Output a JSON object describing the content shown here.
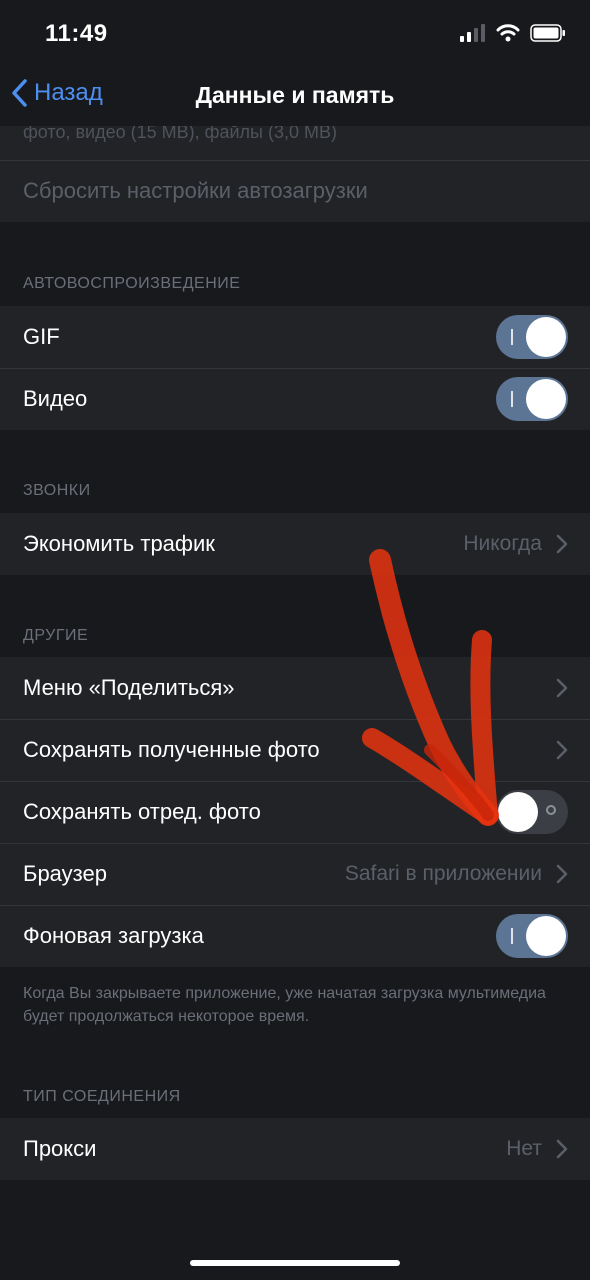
{
  "status": {
    "time": "11:49"
  },
  "nav": {
    "back_label": "Назад",
    "title": "Данные и память"
  },
  "top_group": {
    "partial_text": "фото, видео (15 MB), файлы (3,0 MB)",
    "reset_label": "Сбросить настройки автозагрузки"
  },
  "autoplay": {
    "header": "АВТОВОСПРОИЗВЕДЕНИЕ",
    "items": [
      {
        "label": "GIF",
        "toggle": "on"
      },
      {
        "label": "Видео",
        "toggle": "on"
      }
    ]
  },
  "calls": {
    "header": "ЗВОНКИ",
    "items": [
      {
        "label": "Экономить трафик",
        "value": "Никогда"
      }
    ]
  },
  "other": {
    "header": "ДРУГИЕ",
    "items": [
      {
        "label": "Меню «Поделиться»"
      },
      {
        "label": "Сохранять полученные фото"
      },
      {
        "label": "Сохранять отред. фото",
        "toggle": "off"
      },
      {
        "label": "Браузер",
        "value": "Safari в приложении"
      },
      {
        "label": "Фоновая загрузка",
        "toggle": "on"
      }
    ],
    "footer": "Когда Вы закрываете приложение, уже начатая загрузка мультимедиа будет продолжаться некоторое время."
  },
  "connection": {
    "header": "ТИП СОЕДИНЕНИЯ",
    "items": [
      {
        "label": "Прокси",
        "value": "Нет"
      }
    ]
  },
  "colors": {
    "background": "#18191d",
    "cell": "#212327",
    "accent": "#4c8ff0",
    "toggle_on": "#5d7594",
    "annotation_arrow": "#e8320f"
  },
  "icons": [
    "chevron-left-icon",
    "signal-icon",
    "wifi-icon",
    "battery-icon",
    "chevron-right-icon"
  ]
}
